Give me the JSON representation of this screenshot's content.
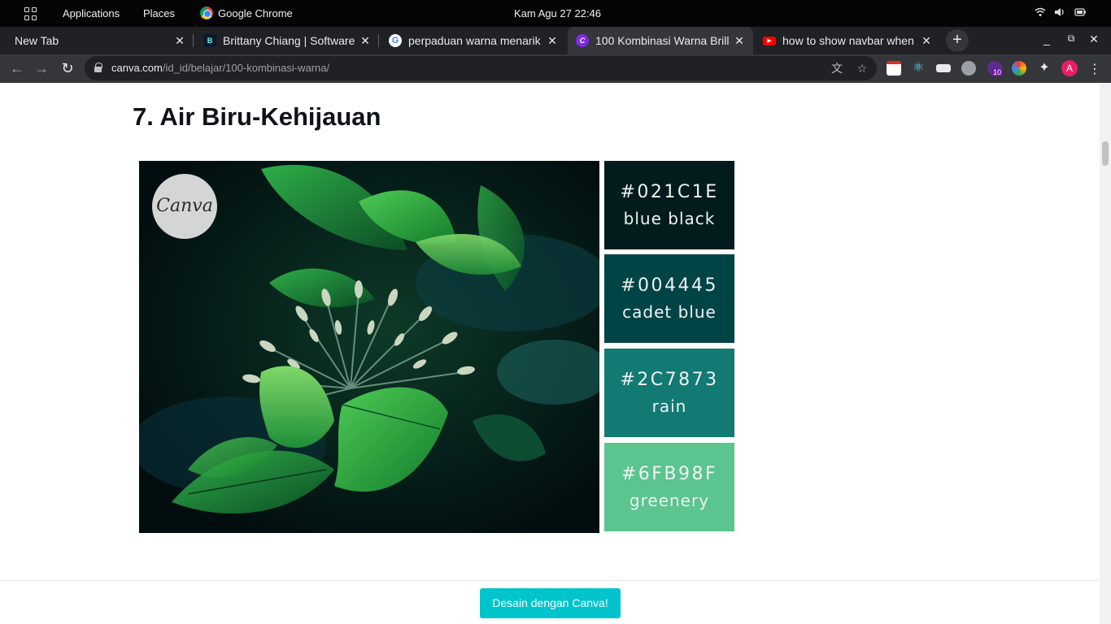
{
  "system_bar": {
    "activities_icon": "grid-icon",
    "applications": "Applications",
    "places": "Places",
    "app_name": "Google Chrome",
    "clock": "Kam Agu 27  22:46",
    "status_icons": [
      "wifi-icon",
      "volume-icon",
      "battery-icon"
    ]
  },
  "tabs": [
    {
      "title": "New Tab",
      "favicon": "none",
      "active": false
    },
    {
      "title": "Brittany Chiang | Software",
      "favicon": "b-icon",
      "active": false
    },
    {
      "title": "perpaduan warna menarik",
      "favicon": "google-icon",
      "active": false
    },
    {
      "title": "100 Kombinasi Warna Brill",
      "favicon": "canva-icon",
      "active": true
    },
    {
      "title": "how to show navbar when",
      "favicon": "youtube-icon",
      "active": false
    }
  ],
  "address_bar": {
    "domain": "canva.com",
    "path": "/id_id/belajar/100-kombinasi-warna/"
  },
  "profile_initial": "A",
  "extension_badge": "10",
  "article": {
    "heading": "7. Air Biru-Kehijauan",
    "image_logo_text": "Canva",
    "palette": [
      {
        "hex": "#021C1E",
        "name": "blue black",
        "color": "#021c1e"
      },
      {
        "hex": "#004445",
        "name": "cadet blue",
        "color": "#004445"
      },
      {
        "hex": "#2C7873",
        "name": "rain",
        "color": "#2c7873"
      },
      {
        "hex": "#6FB98F",
        "name": "greenery",
        "color": "#6fb98f"
      }
    ]
  },
  "cta": {
    "label": "Desain dengan Canva!",
    "color": "#00c4cc"
  }
}
